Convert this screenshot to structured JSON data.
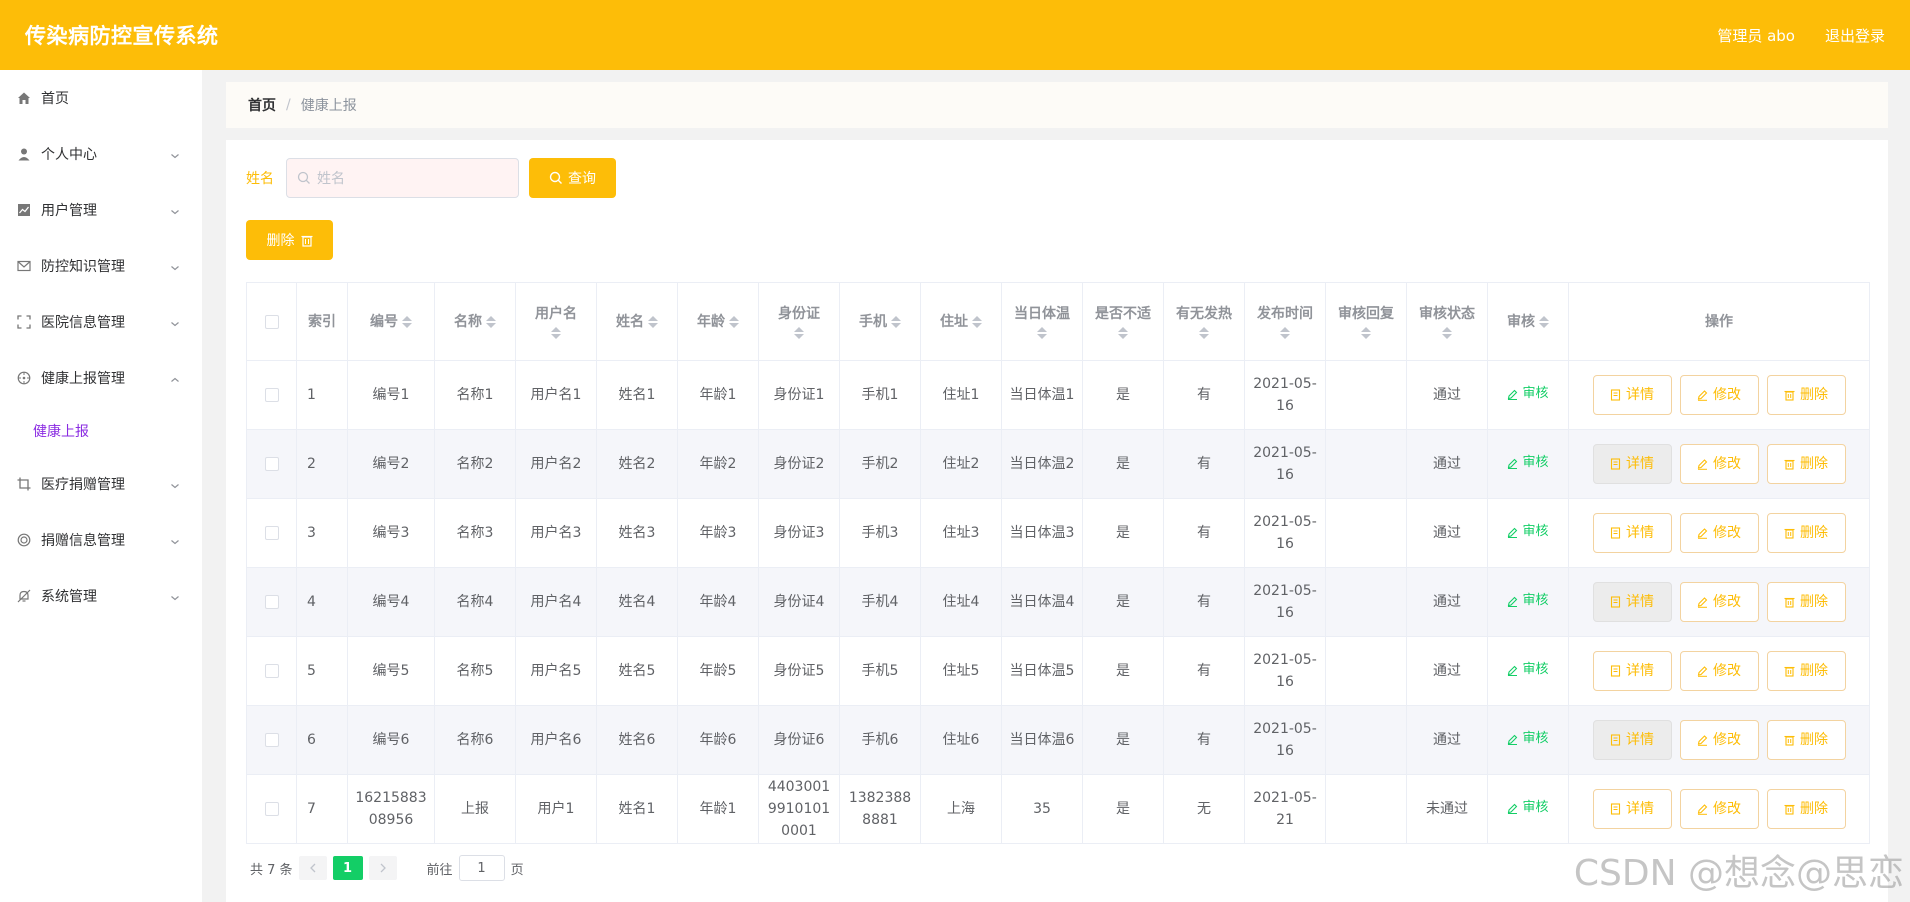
{
  "header": {
    "title": "传染病防控宣传系统",
    "admin": "管理员 abo",
    "logout": "退出登录"
  },
  "sidebar": {
    "items": [
      {
        "label": "首页",
        "icon": "home-icon"
      },
      {
        "label": "个人中心",
        "icon": "user-icon"
      },
      {
        "label": "用户管理",
        "icon": "chart-icon"
      },
      {
        "label": "防控知识管理",
        "icon": "mail-icon"
      },
      {
        "label": "医院信息管理",
        "icon": "fullscreen-icon"
      },
      {
        "label": "健康上报管理",
        "icon": "compass-icon"
      },
      {
        "label": "医疗捐赠管理",
        "icon": "crop-icon"
      },
      {
        "label": "捐赠信息管理",
        "icon": "globe-icon"
      },
      {
        "label": "系统管理",
        "icon": "bell-off-icon"
      }
    ],
    "submenu": "健康上报"
  },
  "breadcrumb": {
    "home": "首页",
    "sep": "/",
    "current": "健康上报"
  },
  "search": {
    "label": "姓名",
    "placeholder": "姓名",
    "button": "查询"
  },
  "actions": {
    "delete": "删除"
  },
  "table": {
    "headers": [
      "索引",
      "编号",
      "名称",
      "用户名",
      "姓名",
      "年龄",
      "身份证",
      "手机",
      "住址",
      "当日体温",
      "是否不适",
      "有无发热",
      "发布时间",
      "审核回复",
      "审核状态",
      "审核",
      "操作"
    ],
    "audit_label": "审核",
    "op_labels": {
      "detail": "详情",
      "edit": "修改",
      "delete": "删除"
    },
    "rows": [
      [
        "1",
        "编号1",
        "名称1",
        "用户名1",
        "姓名1",
        "年龄1",
        "身份证1",
        "手机1",
        "住址1",
        "当日体温1",
        "是",
        "有",
        "2021-05-16",
        "",
        "通过"
      ],
      [
        "2",
        "编号2",
        "名称2",
        "用户名2",
        "姓名2",
        "年龄2",
        "身份证2",
        "手机2",
        "住址2",
        "当日体温2",
        "是",
        "有",
        "2021-05-16",
        "",
        "通过"
      ],
      [
        "3",
        "编号3",
        "名称3",
        "用户名3",
        "姓名3",
        "年龄3",
        "身份证3",
        "手机3",
        "住址3",
        "当日体温3",
        "是",
        "有",
        "2021-05-16",
        "",
        "通过"
      ],
      [
        "4",
        "编号4",
        "名称4",
        "用户名4",
        "姓名4",
        "年龄4",
        "身份证4",
        "手机4",
        "住址4",
        "当日体温4",
        "是",
        "有",
        "2021-05-16",
        "",
        "通过"
      ],
      [
        "5",
        "编号5",
        "名称5",
        "用户名5",
        "姓名5",
        "年龄5",
        "身份证5",
        "手机5",
        "住址5",
        "当日体温5",
        "是",
        "有",
        "2021-05-16",
        "",
        "通过"
      ],
      [
        "6",
        "编号6",
        "名称6",
        "用户名6",
        "姓名6",
        "年龄6",
        "身份证6",
        "手机6",
        "住址6",
        "当日体温6",
        "是",
        "有",
        "2021-05-16",
        "",
        "通过"
      ],
      [
        "7",
        "1621588308956",
        "上报",
        "用户1",
        "姓名1",
        "年龄1",
        "440300199101010001",
        "13823888881",
        "上海",
        "35",
        "是",
        "无",
        "2021-05-21",
        "",
        "未通过"
      ]
    ]
  },
  "pagination": {
    "total": "共 7 条",
    "current": "1",
    "goto_prefix": "前往",
    "goto_value": "1",
    "goto_suffix": "页"
  },
  "watermark": "CSDN @想念@思恋",
  "colors": {
    "primary": "#fdbd08",
    "success": "#13ce66",
    "active_submenu": "#8a2be2"
  }
}
